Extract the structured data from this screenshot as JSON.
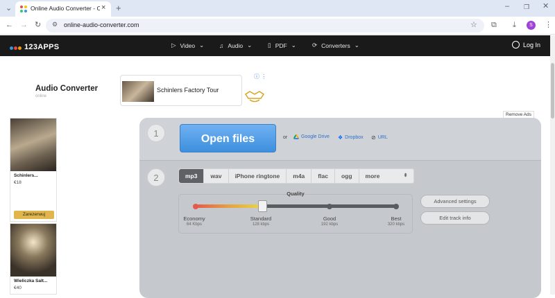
{
  "browser": {
    "tab_title": "Online Audio Converter - Conv",
    "url": "online-audio-converter.com"
  },
  "site": {
    "logo": "123APPS",
    "nav": [
      "Video",
      "Audio",
      "PDF",
      "Converters"
    ],
    "login": "Log In"
  },
  "page": {
    "title": "Audio Converter",
    "subtitle": "online"
  },
  "ads": {
    "banner_text": "Schinlers Factory Tour",
    "remove_ads": "Remove Ads",
    "side": [
      {
        "name": "Schinlers...",
        "price": "€18",
        "button": "Zarezerwuj"
      },
      {
        "name": "Wieliczka Salt...",
        "price": "€40"
      }
    ]
  },
  "converter": {
    "step1": "1",
    "step2": "2",
    "open_files": "Open files",
    "or": "or",
    "google_drive": "Google Drive",
    "dropbox": "Dropbox",
    "url": "URL",
    "formats": [
      "mp3",
      "wav",
      "iPhone ringtone",
      "m4a",
      "flac",
      "ogg",
      "more"
    ],
    "selected_format": "mp3",
    "quality_title": "Quality",
    "quality_levels": [
      {
        "label": "Economy",
        "kbps": "64 Kbps"
      },
      {
        "label": "Standard",
        "kbps": "128 kbps"
      },
      {
        "label": "Good",
        "kbps": "192 kbps"
      },
      {
        "label": "Best",
        "kbps": "320 kbps"
      }
    ],
    "selected_quality": "Standard",
    "quality_fraction": 0.333,
    "advanced_settings": "Advanced settings",
    "edit_track_info": "Edit track info"
  }
}
